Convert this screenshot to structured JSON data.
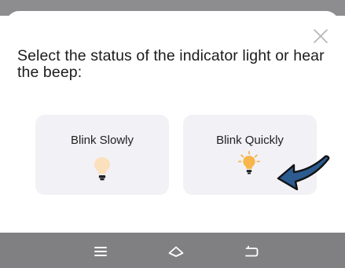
{
  "dialog": {
    "prompt": "Select the status of the indicator light or hear the beep:",
    "close_icon": "close-icon"
  },
  "options": [
    {
      "label": "Blink Slowly",
      "icon": "lightbulb-dim-icon",
      "bulb_color": "#fbe0bd"
    },
    {
      "label": "Blink Quickly",
      "icon": "lightbulb-lit-icon",
      "bulb_color": "#f7b54a"
    }
  ],
  "annotation": {
    "icon": "arrow-pointer-icon",
    "color": "#2b5b8f"
  },
  "navbar": {
    "buttons": [
      "menu-icon",
      "home-icon",
      "back-icon"
    ]
  },
  "colors": {
    "overlay": "#8d8c8f",
    "navbar": "#807f82",
    "card": "#f1f1f6"
  }
}
